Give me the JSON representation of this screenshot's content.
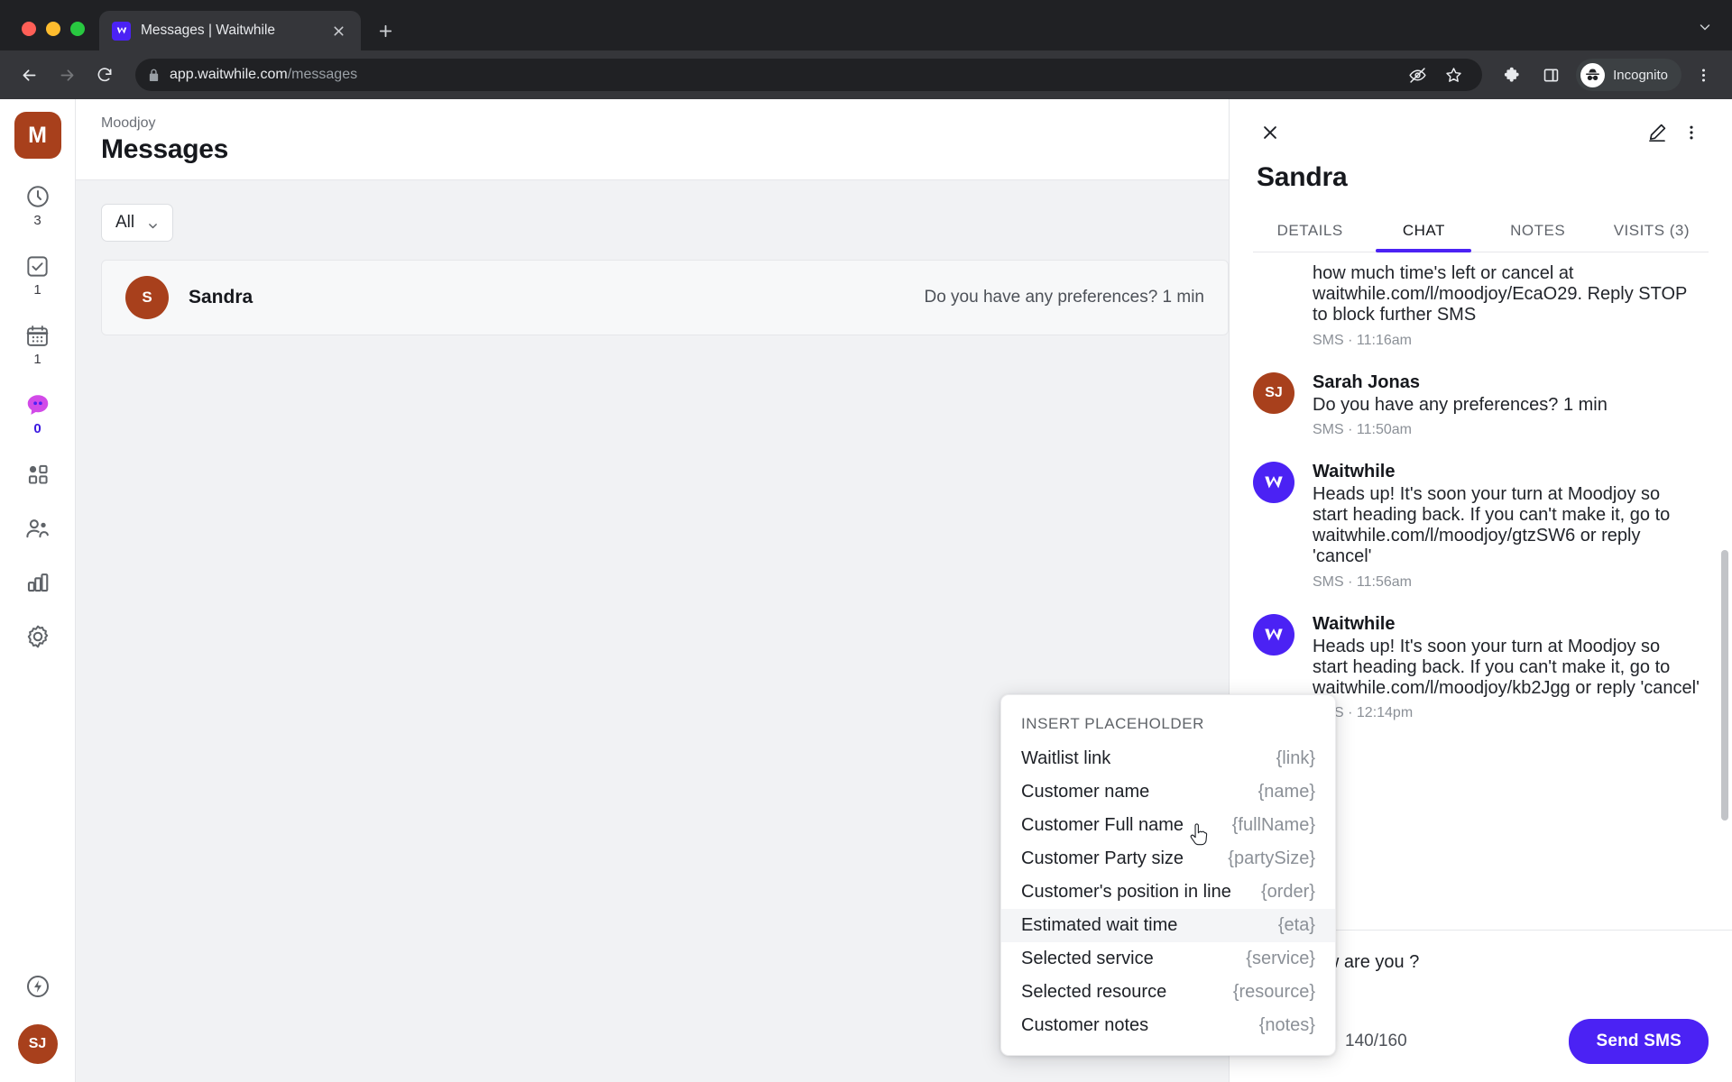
{
  "browser": {
    "tab": {
      "title": "Messages | Waitwhile",
      "favicon_icon": "waitwhile-logo-icon",
      "close_icon": "close-icon"
    },
    "new_tab_label": "+",
    "tab_list_caret": "⌄",
    "nav": {
      "back_icon": "back-arrow-icon",
      "forward_icon": "forward-arrow-icon",
      "reload_icon": "reload-icon"
    },
    "omnibox": {
      "lock_icon": "lock-icon",
      "url_host": "app.waitwhile.com",
      "url_path": "/messages",
      "tracking_icon": "eye-slash-icon",
      "bookmark_icon": "star-icon"
    },
    "extensions_icon": "puzzle-piece-icon",
    "sidepanel_icon": "side-panel-icon",
    "profile": {
      "label": "Incognito",
      "icon": "incognito-icon"
    },
    "menu_icon": "three-dots-vertical-icon"
  },
  "rail": {
    "org_initial": "M",
    "items": [
      {
        "icon": "clock-icon",
        "count": "3",
        "name": "waitlist"
      },
      {
        "icon": "check-square-icon",
        "count": "1",
        "name": "tasks"
      },
      {
        "icon": "calendar-icon",
        "count": "1",
        "name": "calendar"
      },
      {
        "icon": "chat-bubble-icon",
        "count": "0",
        "name": "messages",
        "active": true
      },
      {
        "icon": "apps-grid-icon",
        "count": "",
        "name": "apps"
      },
      {
        "icon": "people-icon",
        "count": "",
        "name": "customers"
      },
      {
        "icon": "bar-chart-icon",
        "count": "",
        "name": "analytics"
      },
      {
        "icon": "gear-icon",
        "count": "",
        "name": "settings"
      }
    ],
    "bottom": {
      "bolt_icon": "bolt-circle-icon",
      "avatar_initials": "SJ"
    }
  },
  "page": {
    "breadcrumb": "Moodjoy",
    "title": "Messages",
    "filter": {
      "value": "All",
      "caret_icon": "chevron-down-icon"
    },
    "conversations": [
      {
        "initial": "S",
        "name": "Sandra",
        "preview": "Do you have any preferences? 1 min"
      }
    ]
  },
  "placeholder_popup": {
    "title": "INSERT PLACEHOLDER",
    "items": [
      {
        "label": "Waitlist link",
        "token": "{link}",
        "highlighted": false
      },
      {
        "label": "Customer name",
        "token": "{name}",
        "highlighted": false
      },
      {
        "label": "Customer Full name",
        "token": "{fullName}",
        "highlighted": false
      },
      {
        "label": "Customer Party size",
        "token": "{partySize}",
        "highlighted": false
      },
      {
        "label": "Customer's position in line",
        "token": "{order}",
        "highlighted": false
      },
      {
        "label": "Estimated wait time",
        "token": "{eta}",
        "highlighted": true
      },
      {
        "label": "Selected service",
        "token": "{service}",
        "highlighted": false
      },
      {
        "label": "Selected resource",
        "token": "{resource}",
        "highlighted": false
      },
      {
        "label": "Customer notes",
        "token": "{notes}",
        "highlighted": false
      }
    ]
  },
  "panel": {
    "close_icon": "close-icon",
    "edit_icon": "pencil-edit-icon",
    "more_icon": "three-dots-vertical-icon",
    "customer_name": "Sandra",
    "tabs": [
      {
        "label": "DETAILS",
        "selected": false
      },
      {
        "label": "CHAT",
        "selected": true
      },
      {
        "label": "NOTES",
        "selected": false
      },
      {
        "label": "VISITS (3)",
        "selected": false
      }
    ],
    "messages": [
      {
        "avatar": "",
        "avatar_kind": "none",
        "sender": "",
        "text": "how much time's left or cancel at waitwhile.com/l/moodjoy/EcaO29. Reply STOP to block further SMS",
        "meta": "SMS · 11:16am",
        "clipped": true
      },
      {
        "avatar": "SJ",
        "avatar_kind": "sj",
        "sender": "Sarah Jonas",
        "text": "Do you have any preferences? 1 min",
        "meta": "SMS · 11:50am",
        "clipped": false
      },
      {
        "avatar": "W",
        "avatar_kind": "ww",
        "sender": "Waitwhile",
        "text": "Heads up! It's soon your turn at Moodjoy so start heading back. If you can't make it, go to waitwhile.com/l/moodjoy/gtzSW6 or reply 'cancel'",
        "meta": "SMS · 11:56am",
        "clipped": false
      },
      {
        "avatar": "W",
        "avatar_kind": "ww",
        "sender": "Waitwhile",
        "text": "Heads up! It's soon your turn at Moodjoy so start heading back. If you can't make it, go to waitwhile.com/l/moodjoy/kb2Jgg or reply 'cancel'",
        "meta": "SMS · 12:14pm",
        "clipped": false
      }
    ],
    "composer": {
      "value": "Hello, how are you ?",
      "add_icon": "plus-circle-icon",
      "template_icon": "bookmark-icon",
      "char_count": "140/160",
      "send_label": "Send SMS"
    }
  },
  "colors": {
    "accent": "#4b22f4",
    "org": "#a8401c",
    "chrome_dark": "#202124",
    "chrome_toolbar": "#35363a",
    "page_bg": "#f1f2f4",
    "badge_purple": "#3a18e0"
  }
}
